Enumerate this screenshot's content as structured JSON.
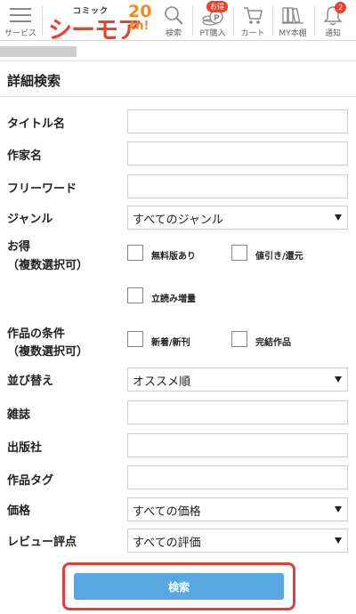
{
  "header": {
    "menu_label": "サービス",
    "logo": {
      "small": "コミック",
      "main": "シーモア",
      "anniv_num": "20",
      "anniv_suffix": "th!"
    },
    "nav": [
      {
        "label": "検索",
        "icon": "search-icon"
      },
      {
        "label": "PT購入",
        "icon": "coin-icon",
        "badge": "お得"
      },
      {
        "label": "カート",
        "icon": "cart-icon"
      },
      {
        "label": "MY本棚",
        "icon": "bookshelf-icon"
      },
      {
        "label": "通知",
        "icon": "bell-icon",
        "badge": "2"
      }
    ]
  },
  "page_title": "詳細検索",
  "form": {
    "title_label": "タイトル名",
    "author_label": "作家名",
    "freeword_label": "フリーワード",
    "genre_label": "ジャンル",
    "genre_value": "すべてのジャンル",
    "otoku_label_1": "お得",
    "otoku_label_2": "（複数選択可）",
    "otoku_options": [
      "無料版あり",
      "値引き/還元",
      "立読み増量"
    ],
    "condition_label_1": "作品の条件",
    "condition_label_2": "（複数選択可）",
    "condition_options": [
      "新着/新刊",
      "完結作品"
    ],
    "sort_label": "並び替え",
    "sort_value": "オススメ順",
    "magazine_label": "雑誌",
    "publisher_label": "出版社",
    "tag_label": "作品タグ",
    "price_label": "価格",
    "price_value": "すべての価格",
    "review_label": "レビュー評点",
    "review_value": "すべての評価",
    "submit_label": "検索"
  },
  "colors": {
    "accent_red": "#e8432d",
    "button_blue": "#57a7e3",
    "highlight_red": "#e0403a"
  }
}
